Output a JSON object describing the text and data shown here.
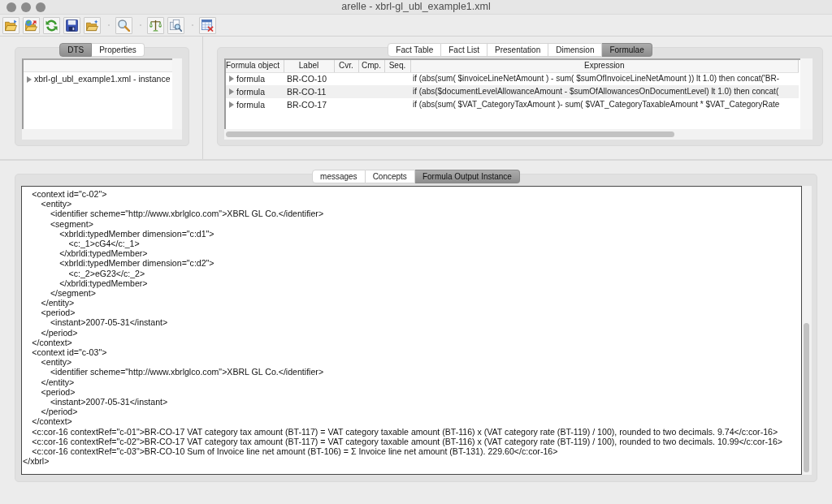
{
  "window": {
    "title": "arelle - xbrl-gl_ubl_example1.xml"
  },
  "dts_panel": {
    "tabs": [
      {
        "label": "DTS",
        "selected": true
      },
      {
        "label": "Properties",
        "selected": false
      }
    ],
    "tree": [
      {
        "label": "xbrl-gl_ubl_example1.xml - instance",
        "expanded": false
      }
    ]
  },
  "formula_panel": {
    "tabs": [
      {
        "label": "Fact Table",
        "selected": false
      },
      {
        "label": "Fact List",
        "selected": false
      },
      {
        "label": "Presentation",
        "selected": false
      },
      {
        "label": "Dimension",
        "selected": false
      },
      {
        "label": "Formulae",
        "selected": true
      }
    ],
    "table": {
      "columns": [
        "Formula object",
        "Label",
        "Cvr.",
        "Cmp.",
        "Seq.",
        "Expression"
      ],
      "rows": [
        {
          "formula_object": "formula",
          "label": "BR-CO-10",
          "expression": "if (abs(sum( $invoiceLineNetAmount ) - sum( $sumOfInvoiceLineNetAmount )) lt 1.0) then concat('BR-",
          "expanded": false
        },
        {
          "formula_object": "formula",
          "label": "BR-CO-11",
          "expression": "if (abs($documentLevelAllowanceAmount - $sumOfAllowancesOnDocumentLevel) lt 1.0) then concat(",
          "expanded": false
        },
        {
          "formula_object": "formula",
          "label": "BR-CO-17",
          "expression": "if (abs(sum( $VAT_CategoryTaxAmount )- sum( $VAT_CategoryTaxableAmount * $VAT_CategoryRate",
          "expanded": false
        }
      ]
    }
  },
  "output_panel": {
    "tabs": [
      {
        "label": "messages",
        "selected": false
      },
      {
        "label": "Concepts",
        "selected": false
      },
      {
        "label": "Formula Output Instance",
        "selected": true
      }
    ],
    "listing": [
      {
        "children": [
          {
            "open": "<context id=\"c-02\">",
            "children": [
              {
                "open": "<entity>",
                "children": [
                  {
                    "text": "<identifier scheme=\"http://www.xbrlglco.com\">XBRL GL Co.</identifier>"
                  },
                  {
                    "open": "<segment>",
                    "children": [
                      {
                        "open": "<xbrldi:typedMember dimension=\"c:d1\">",
                        "children": [
                          {
                            "text": "<c:_1>cG4</c:_1>"
                          }
                        ],
                        "close": "</xbrldi:typedMember>"
                      },
                      {
                        "open": "<xbrldi:typedMember dimension=\"c:d2\">",
                        "children": [
                          {
                            "text": "<c:_2>eG23</c:_2>"
                          }
                        ],
                        "close": "</xbrldi:typedMember>"
                      }
                    ],
                    "close": "</segment>"
                  }
                ],
                "close": "</entity>"
              },
              {
                "open": "<period>",
                "children": [
                  {
                    "text": "<instant>2007-05-31</instant>"
                  }
                ],
                "close": "</period>"
              }
            ],
            "close": "</context>"
          },
          {
            "open": "<context id=\"c-03\">",
            "children": [
              {
                "open": "<entity>",
                "children": [
                  {
                    "text": "<identifier scheme=\"http://www.xbrlglco.com\">XBRL GL Co.</identifier>"
                  }
                ],
                "close": "</entity>"
              },
              {
                "open": "<period>",
                "children": [
                  {
                    "text": "<instant>2007-05-31</instant>"
                  }
                ],
                "close": "</period>"
              }
            ],
            "close": "</context>"
          },
          {
            "text": "<c:cor-16 contextRef=\"c-01\">BR-CO-17 VAT category tax amount (BT-117) = VAT category taxable amount (BT-116) x (VAT category rate (BT-119) / 100), rounded to two decimals. 9.74</c:cor-16>"
          },
          {
            "text": "<c:cor-16 contextRef=\"c-02\">BR-CO-17 VAT category tax amount (BT-117) = VAT category taxable amount (BT-116) x (VAT category rate (BT-119) / 100), rounded to two decimals. 10.99</c:cor-16>"
          },
          {
            "text": "<c:cor-16 contextRef=\"c-03\">BR-CO-10 Sum of Invoice line net amount (BT-106) = Σ Invoice line net amount (BT-131). 229.60</c:cor-16>"
          }
        ],
        "close": "</xbrl>"
      }
    ]
  }
}
